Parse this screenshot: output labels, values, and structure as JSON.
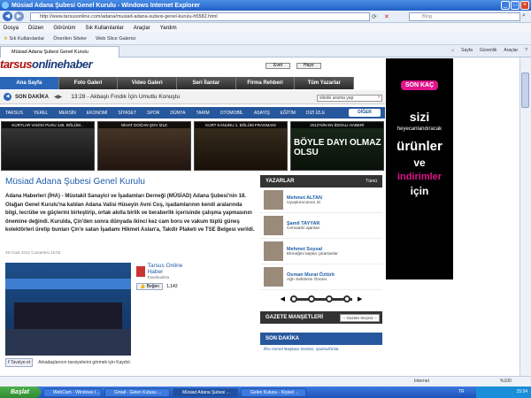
{
  "window": {
    "title": "Müsiad Adana Şubesi Genel Kurulu - Windows Internet Explorer"
  },
  "address": {
    "url": "http://www.tarsusonline.com/adana/musiad-adana-subesi-genel-kurulu-h5582.html",
    "search_placeholder": "Bing"
  },
  "menu": [
    "Dosya",
    "Düzen",
    "Görünüm",
    "Sık Kullanılanlar",
    "Araçlar",
    "Yardım"
  ],
  "favbar": {
    "favorites": "Sık Kullanılanlar",
    "suggested": "Önerilen Siteler",
    "webslice": "Web Slice Galerisi"
  },
  "tab": {
    "label": "Müsiad Adana Şubesi Genel Kurulu"
  },
  "commandbar": [
    "Sayfa",
    "Güvenlik",
    "Araçlar"
  ],
  "site": {
    "logo_main": "tarsus",
    "logo_rest": "onlinehaber",
    "popup_buttons": [
      "Evet",
      "Hayır"
    ],
    "nav": [
      "Ana Sayfa",
      "Foto Galeri",
      "Video Galeri",
      "Seri İlanlar",
      "Firma Rehberi",
      "Tüm Yazarlar"
    ],
    "ticker_label": "SON DAKİKA",
    "ticker_text": "13:28 - Akbaşlı Fındık İçin Umutlu Konuştu",
    "search_placeholder": "sitede arama yap",
    "categories": [
      "TARSUS",
      "YEREL",
      "MERSİN",
      "EKONOMİ",
      "SİYASET",
      "SPOR",
      "DÜNYA",
      "TARIM",
      "OTOMOBİL",
      "ASAYİŞ",
      "EĞİTİM",
      "DİZİ İZLE"
    ],
    "diger": "DİĞER",
    "videos": [
      {
        "caption": "KURTLAR VADİSİ PUSU 145. BÖLÜM..."
      },
      {
        "caption": "NİHAT DOĞAN ŞOV İZLE"
      },
      {
        "caption": "KURT KANUNU 1. BÖLÜM FRAGMANI"
      },
      {
        "caption": "2012'NİN EN İDDİALI HABERİ"
      }
    ],
    "video4_text": "BÖYLE DAYI OLMAZ OLSU",
    "article": {
      "title": "Müsiad Adana Şubesi Genel Kurulu",
      "body": "Adana Haberleri (İHA) - Müstakil Sanayici ve İşadamları Derneği (MÜSİAD) Adana Şubesi'nin 18. Olağan Genel Kurulu'na katılan Adana Valisi Hüseyin Avni Coş, işadamlarının kendi aralarında bilgi, tecrübe ve güçlerini birleştirip, ortak akılla birlik ve beraberlik içerisinde çalışma yapmasının önemine değindi. Kurulda, Çin'den sonra dünyada ikinci kez cam boru ve vakum tüplü güneş kolektörleri üretip bunları Çin'e satan İşadamı Hikmet Aslan'a, Takdir Plaketi ve TSE Belgesi verildi.",
      "date": "29 Ocak 2012 Cumartesi 15:03",
      "share": {
        "page": "Tarsus Online Haber",
        "network": "Facebook'ta",
        "like": "Beğen",
        "count": "1,142",
        "tavsiye": "Tavsiye et",
        "friends": "Arkadaşlarının tavsiyelerini görmek için Kaydol."
      }
    },
    "sidebar": {
      "title": "YAZARLAR",
      "all": "Tümü",
      "authors": [
        {
          "name": "Mehmet ALTAN",
          "desc": "Uyuşturucunun izi"
        },
        {
          "name": "Şamil TAYYAR",
          "desc": "Cemaatin ajanları"
        },
        {
          "name": "Mehmet Soysal",
          "desc": "Ekmeğini taştan çıkartanlar"
        },
        {
          "name": "Osman Murat Öztürk",
          "desc": "Ağrı Sektörün Önünü"
        }
      ],
      "manset_title": "GAZETE MANŞETLERİ",
      "manset_select": "-- Gazete Seçiniz --",
      "sondakika_title": "SON DAKİKA",
      "sondakika_item": "İlho Genel Başkanı Destici, Şanlıurfa'da"
    },
    "ad": {
      "brand": "SON KAÇ",
      "line1": "sizi",
      "line2": "heyecanlandıracak",
      "line3": "ürünler",
      "line4": "ve",
      "line5": "indirimler",
      "line6": "için"
    }
  },
  "status": {
    "zone": "Internet",
    "zoom": "%100"
  },
  "taskbar": {
    "start": "Başlat",
    "tasks": [
      "WebCam - Windows I...",
      "Gmail - Gelen Kutusu ...",
      "Müsiad Adana Şubesi ...",
      "Gelen Kutusu - Kişisel ..."
    ],
    "lang": "TR",
    "time": "15:34"
  },
  "colors": {
    "accent": "#1f5fa8",
    "navbar": "#2a66b8",
    "catbar": "#27579c",
    "ad_pink": "#e0148c",
    "logo_red": "#b01010"
  }
}
